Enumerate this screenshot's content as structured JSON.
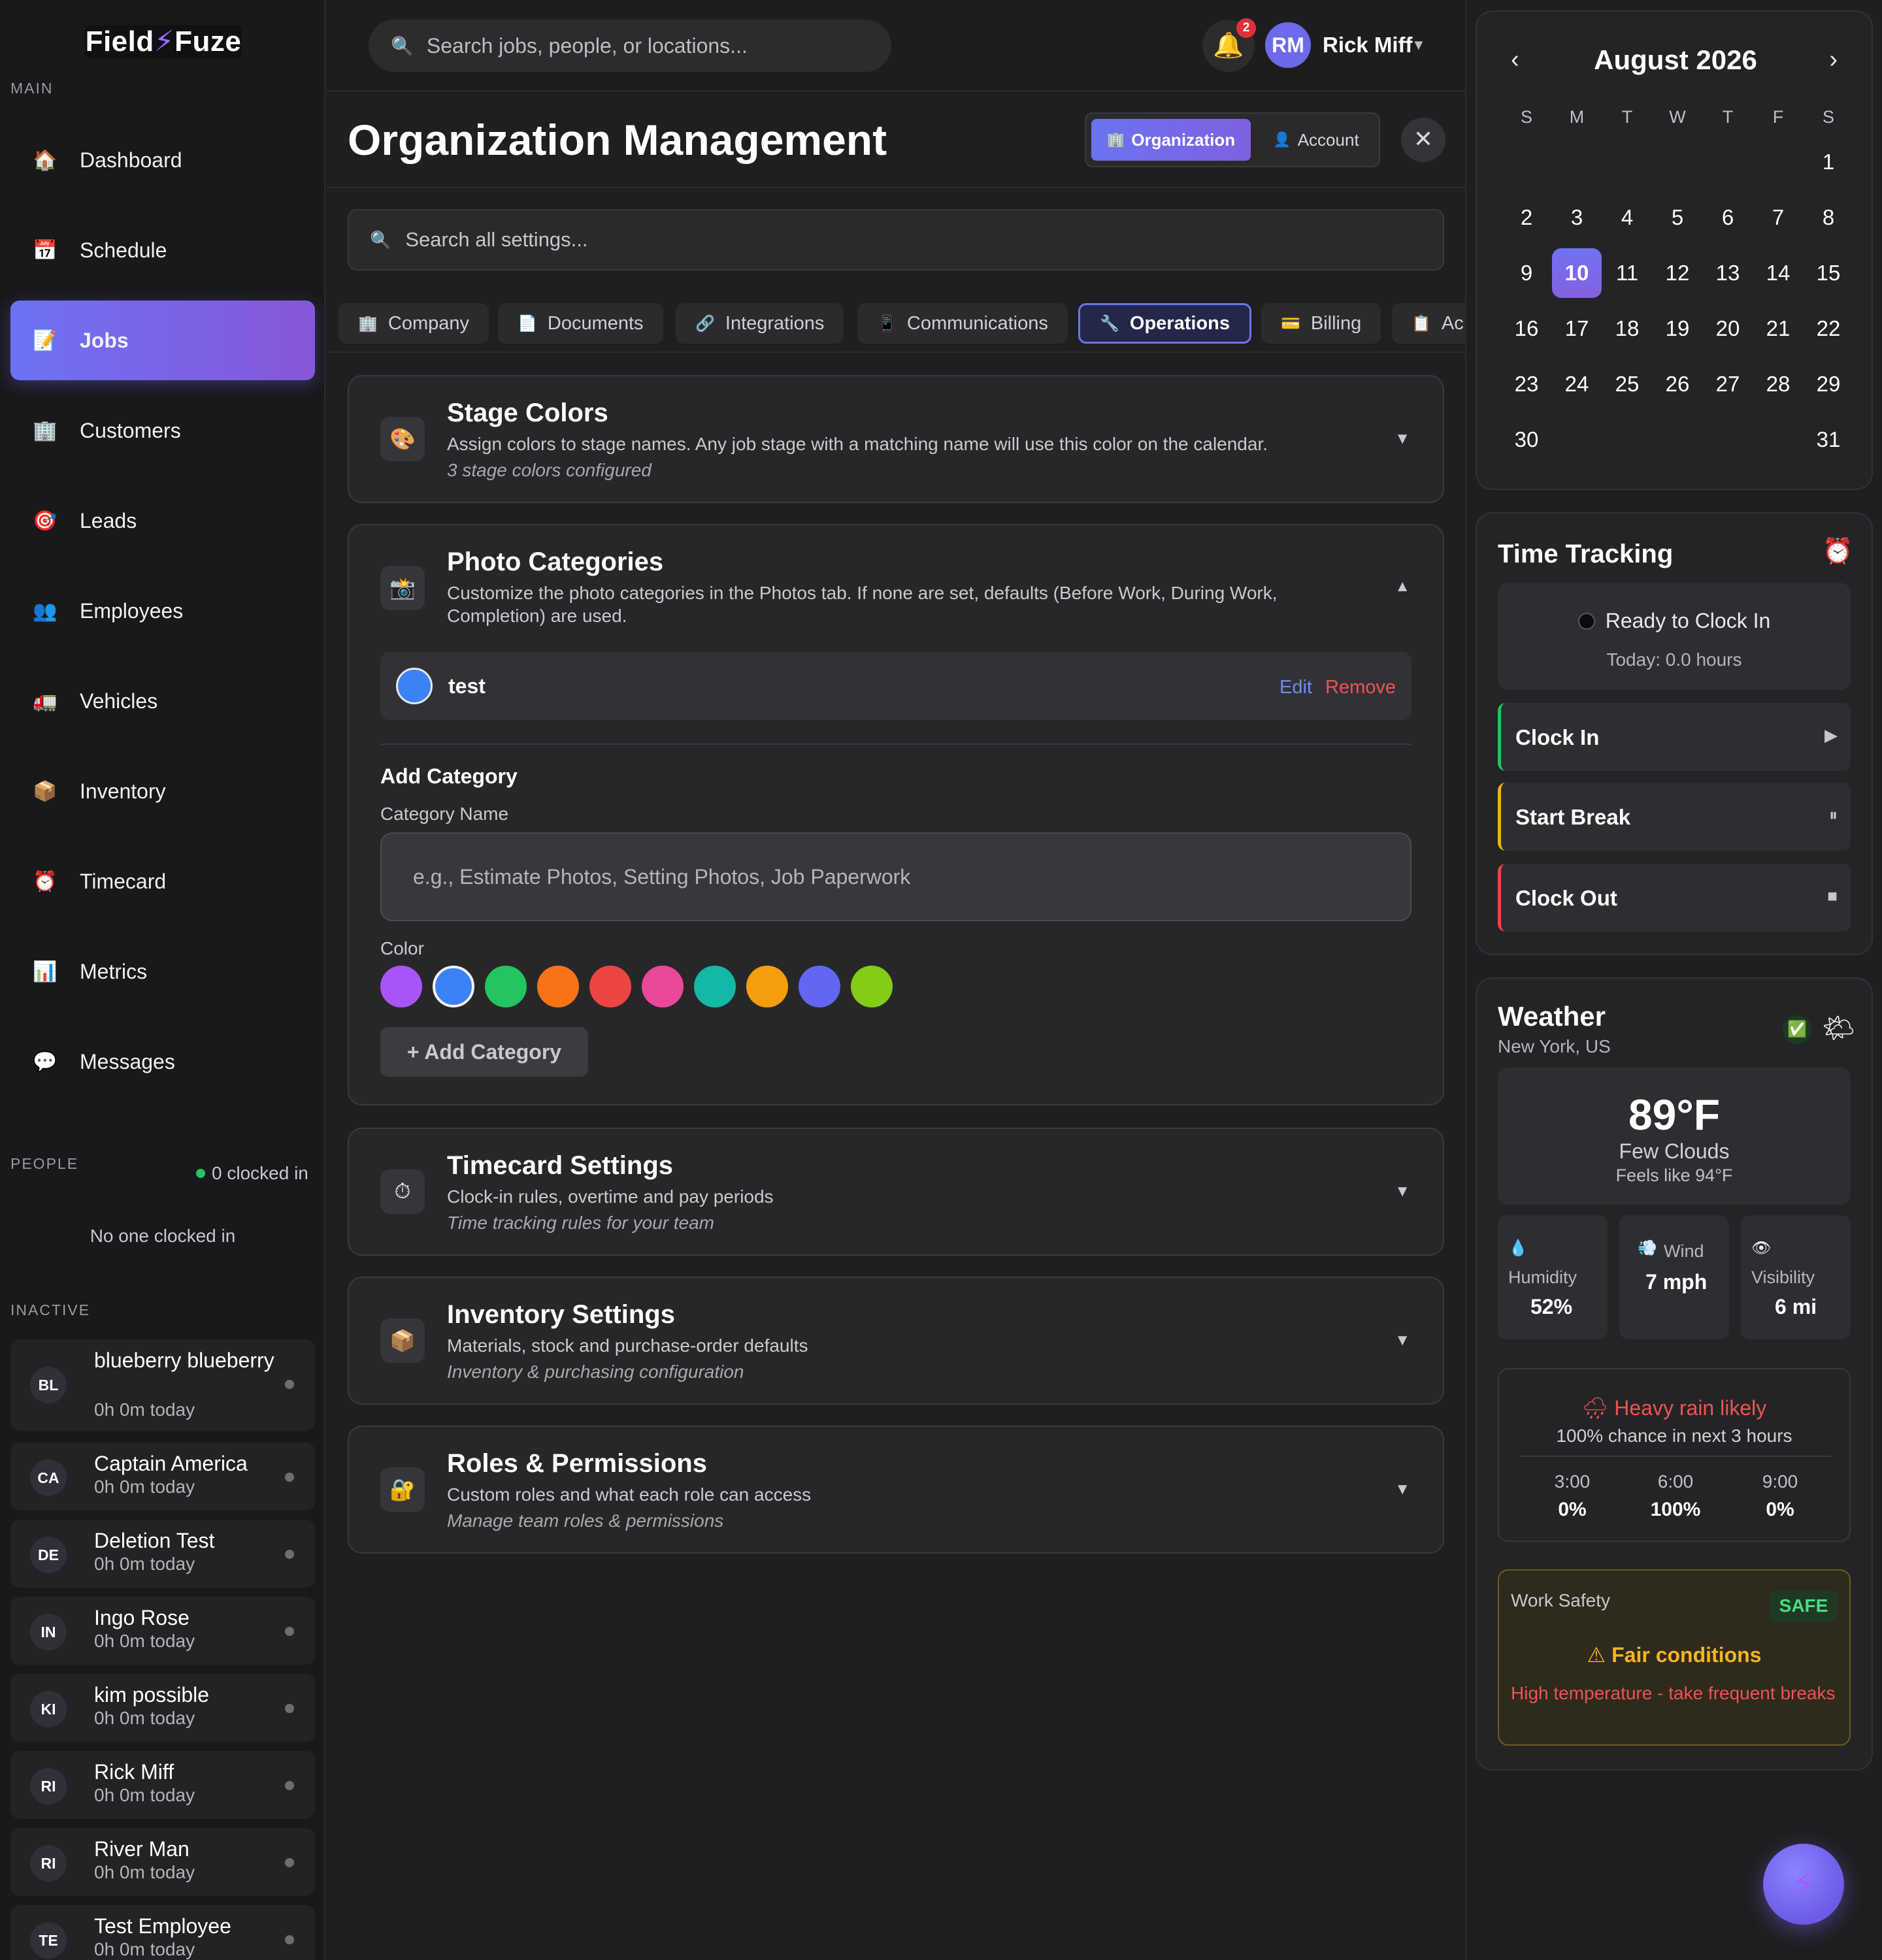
{
  "brand": {
    "name_left": "Field",
    "name_right": "Fuze"
  },
  "sidebar": {
    "main_label": "MAIN",
    "nav": [
      {
        "label": "Dashboard",
        "icon": "🏠"
      },
      {
        "label": "Schedule",
        "icon": "📅"
      },
      {
        "label": "Jobs",
        "icon": "📝"
      },
      {
        "label": "Customers",
        "icon": "🏢"
      },
      {
        "label": "Leads",
        "icon": "🎯"
      },
      {
        "label": "Employees",
        "icon": "👥"
      },
      {
        "label": "Vehicles",
        "icon": "🚛"
      },
      {
        "label": "Inventory",
        "icon": "📦"
      },
      {
        "label": "Timecard",
        "icon": "⏰"
      },
      {
        "label": "Metrics",
        "icon": "📊"
      },
      {
        "label": "Messages",
        "icon": "💬"
      }
    ],
    "people_label": "PEOPLE",
    "clocked_in": "0 clocked in",
    "no_one": "No one clocked in",
    "inactive_label": "INACTIVE",
    "employees": [
      {
        "initials": "BL",
        "name": "blueberry blueberry",
        "time": "0h 0m today"
      },
      {
        "initials": "CA",
        "name": "Captain America",
        "time": "0h 0m today"
      },
      {
        "initials": "DE",
        "name": "Deletion Test",
        "time": "0h 0m today"
      },
      {
        "initials": "IN",
        "name": "Ingo Rose",
        "time": "0h 0m today"
      },
      {
        "initials": "KI",
        "name": "kim possible",
        "time": "0h 0m today"
      },
      {
        "initials": "RI",
        "name": "Rick Miff",
        "time": "0h 0m today"
      },
      {
        "initials": "RI",
        "name": "River Man",
        "time": "0h 0m today"
      },
      {
        "initials": "TE",
        "name": "Test Employee",
        "time": "0h 0m today"
      }
    ]
  },
  "topbar": {
    "search_placeholder": "Search jobs, people, or locations...",
    "notif_count": "2",
    "user_initials": "RM",
    "user_name": "Rick Miff"
  },
  "main": {
    "title": "Organization Management",
    "seg": {
      "organization": "Organization",
      "account": "Account"
    },
    "settings_search_placeholder": "Search all settings...",
    "tabs": [
      {
        "label": "Company",
        "icon": "🏢"
      },
      {
        "label": "Documents",
        "icon": "📄"
      },
      {
        "label": "Integrations",
        "icon": "🔗"
      },
      {
        "label": "Communications",
        "icon": "📱"
      },
      {
        "label": "Operations",
        "icon": "🔧"
      },
      {
        "label": "Billing",
        "icon": "💳"
      },
      {
        "label": "Ac",
        "icon": "📋"
      }
    ],
    "cards": {
      "stage": {
        "icon": "🎨",
        "title": "Stage Colors",
        "desc": "Assign colors to stage names. Any job stage with a matching name will use this color on the calendar.",
        "sub": "3 stage colors configured"
      },
      "photo": {
        "icon": "📸",
        "title": "Photo Categories",
        "desc": "Customize the photo categories in the Photos tab. If none are set, defaults (Before Work, During Work, Completion) are used.",
        "item_name": "test",
        "edit": "Edit",
        "remove": "Remove",
        "add_heading": "Add Category",
        "name_label": "Category Name",
        "name_placeholder": "e.g., Estimate Photos, Setting Photos, Job Paperwork",
        "color_label": "Color",
        "colors": [
          "#a855f7",
          "#3b82f6",
          "#22c55e",
          "#f97316",
          "#ef4444",
          "#ec4899",
          "#14b8a6",
          "#f59e0b",
          "#6366f1",
          "#84cc16"
        ],
        "add_button": "+ Add Category"
      },
      "timecard": {
        "icon": "⏱",
        "title": "Timecard Settings",
        "desc": "Clock-in rules, overtime and pay periods",
        "sub": "Time tracking rules for your team"
      },
      "inventory": {
        "icon": "📦",
        "title": "Inventory Settings",
        "desc": "Materials, stock and purchase-order defaults",
        "sub": "Inventory & purchasing configuration"
      },
      "roles": {
        "icon": "🔐",
        "title": "Roles & Permissions",
        "desc": "Custom roles and what each role can access",
        "sub": "Manage team roles & permissions"
      }
    }
  },
  "calendar": {
    "month": "August 2026",
    "dow": [
      "S",
      "M",
      "T",
      "W",
      "T",
      "F",
      "S"
    ],
    "days": [
      [
        "",
        "",
        "",
        "",
        "",
        "",
        "1"
      ],
      [
        "2",
        "3",
        "4",
        "5",
        "6",
        "7",
        "8"
      ],
      [
        "9",
        "10",
        "11",
        "12",
        "13",
        "14",
        "15"
      ],
      [
        "16",
        "17",
        "18",
        "19",
        "20",
        "21",
        "22"
      ],
      [
        "23",
        "24",
        "25",
        "26",
        "27",
        "28",
        "29"
      ],
      [
        "30",
        "",
        "",
        "",
        "",
        "",
        "31"
      ]
    ],
    "today": "10"
  },
  "time_tracking": {
    "title": "Time Tracking",
    "status": "Ready to Clock In",
    "today": "Today: 0.0 hours",
    "buttons": [
      {
        "label": "Clock In",
        "icon": "▶",
        "color": "#22c55e"
      },
      {
        "label": "Start Break",
        "icon": "⏸",
        "color": "#eab308"
      },
      {
        "label": "Clock Out",
        "icon": "■",
        "color": "#ef4444"
      }
    ]
  },
  "weather": {
    "title": "Weather",
    "location": "New York, US",
    "temp": "89°F",
    "condition": "Few Clouds",
    "feels": "Feels like 94°F",
    "stats": [
      {
        "icon": "💧",
        "label": "Humidity",
        "value": "52%"
      },
      {
        "icon": "💨",
        "label": "Wind",
        "value": "7 mph"
      },
      {
        "icon": "👁",
        "label": "Visibility",
        "value": "6 mi"
      }
    ],
    "rain_heading": "Heavy rain likely",
    "rain_sub": "100% chance in next 3 hours",
    "hours": [
      {
        "time": "3:00",
        "pct": "0%"
      },
      {
        "time": "6:00",
        "pct": "100%"
      },
      {
        "time": "9:00",
        "pct": "0%"
      }
    ],
    "safety": {
      "label": "Work Safety",
      "badge": "SAFE",
      "condition": "Fair conditions",
      "warning": "High temperature - take frequent breaks"
    }
  }
}
